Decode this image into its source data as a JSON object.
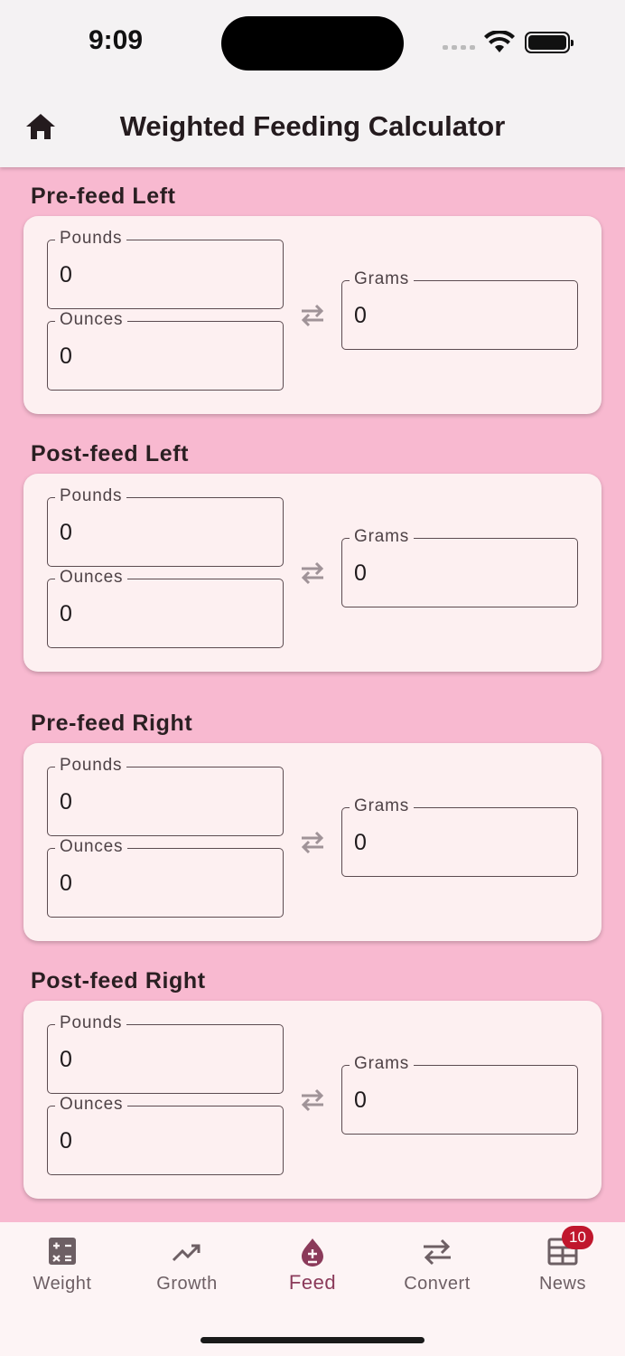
{
  "status_bar": {
    "time": "9:09"
  },
  "app_bar": {
    "title": "Weighted Feeding Calculator",
    "home_icon": "home-icon"
  },
  "sections": [
    {
      "title": "Pre-feed Left",
      "pounds_label": "Pounds",
      "pounds_value": "0",
      "ounces_label": "Ounces",
      "ounces_value": "0",
      "grams_label": "Grams",
      "grams_value": "0"
    },
    {
      "title": "Post-feed Left",
      "pounds_label": "Pounds",
      "pounds_value": "0",
      "ounces_label": "Ounces",
      "ounces_value": "0",
      "grams_label": "Grams",
      "grams_value": "0"
    },
    {
      "title": "Pre-feed Right",
      "pounds_label": "Pounds",
      "pounds_value": "0",
      "ounces_label": "Ounces",
      "ounces_value": "0",
      "grams_label": "Grams",
      "grams_value": "0"
    },
    {
      "title": "Post-feed Right",
      "pounds_label": "Pounds",
      "pounds_value": "0",
      "ounces_label": "Ounces",
      "ounces_value": "0",
      "grams_label": "Grams",
      "grams_value": "0"
    }
  ],
  "bottom_nav": {
    "items": [
      {
        "label": "Weight",
        "icon": "calculator-icon"
      },
      {
        "label": "Growth",
        "icon": "trending-up-icon"
      },
      {
        "label": "Feed",
        "icon": "drop-plus-icon",
        "active": true
      },
      {
        "label": "Convert",
        "icon": "swap-arrows-icon"
      },
      {
        "label": "News",
        "icon": "newspaper-icon",
        "badge": "10"
      }
    ]
  },
  "colors": {
    "background": "#f8b9d0",
    "card": "#fdf0f1",
    "app_bar": "#f4f2f3",
    "active_nav": "#8b3a5a",
    "badge": "#c0172d"
  }
}
